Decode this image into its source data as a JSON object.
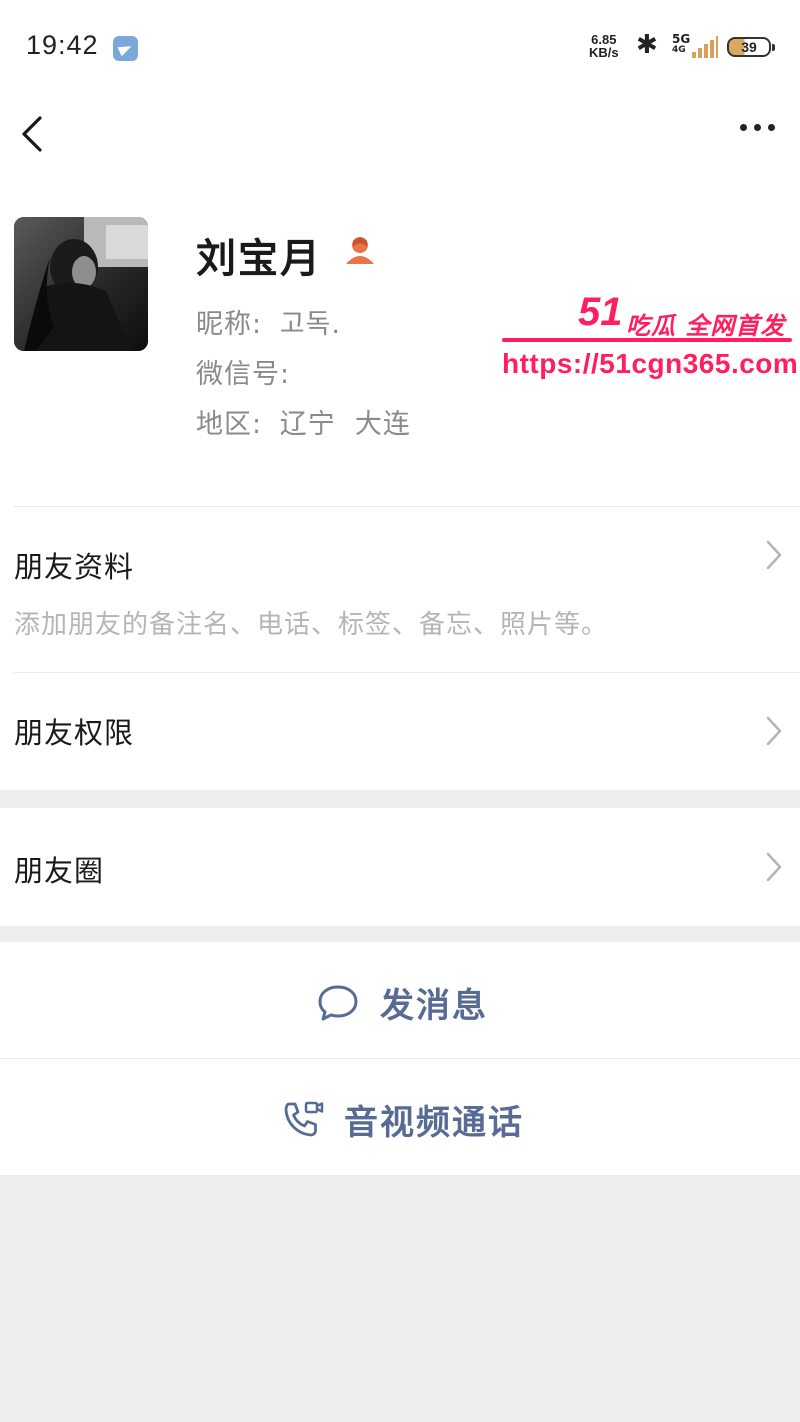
{
  "status_bar": {
    "time": "19:42",
    "net_speed_value": "6.85",
    "net_speed_unit": "KB/s",
    "network_type": "5G",
    "network_sub": "4G",
    "battery": "39",
    "icons": [
      "telegram-icon",
      "bluetooth-icon",
      "signal-icon",
      "battery-icon"
    ]
  },
  "nav": {
    "back_icon": "chevron-left-icon",
    "more_icon": "more-icon"
  },
  "profile": {
    "name": "刘宝月",
    "gender_icon": "female-user-icon",
    "nickname_label": "昵称:",
    "nickname_value": "고독.",
    "wechat_id_label": "微信号:",
    "wechat_id_value": "",
    "region_label": "地区:",
    "region_value": "辽宁  大连"
  },
  "watermark": {
    "brand_number": "51",
    "slogan": "吃瓜 全网首发",
    "url": "https://51cgn365.com"
  },
  "menu": [
    {
      "title": "朋友资料",
      "subtitle": "添加朋友的备注名、电话、标签、备忘、照片等。"
    },
    {
      "title": "朋友权限"
    },
    {
      "title": "朋友圈"
    }
  ],
  "actions": {
    "message_label": "发消息",
    "call_label": "音视频通话"
  },
  "colors": {
    "link_blue": "#576b95",
    "watermark_pink": "#ff1f5e",
    "background_gray": "#ededed"
  }
}
